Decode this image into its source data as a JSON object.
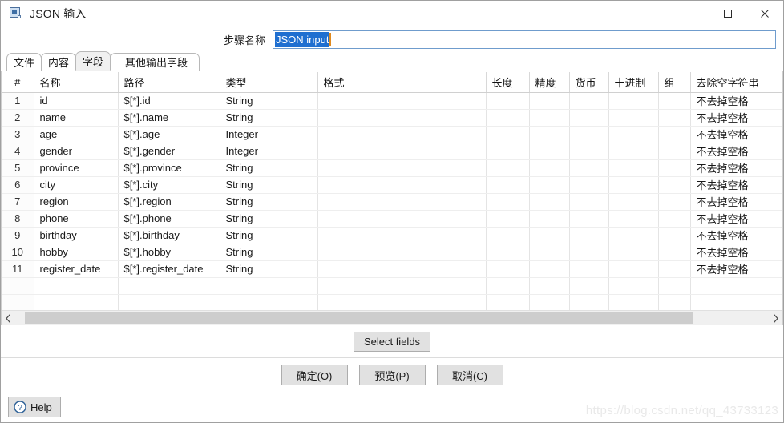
{
  "window": {
    "title": "JSON 输入",
    "icon": "json-step-icon",
    "controls": {
      "minimize": "minimize-icon",
      "maximize": "maximize-icon",
      "close": "close-icon"
    }
  },
  "step": {
    "label": "步骤名称",
    "value": "JSON input",
    "placeholder": ""
  },
  "tabs": [
    {
      "label": "文件",
      "active": false
    },
    {
      "label": "内容",
      "active": false
    },
    {
      "label": "字段",
      "active": true
    },
    {
      "label": "其他输出字段",
      "active": false
    }
  ],
  "fields_table": {
    "columns": [
      "#",
      "名称",
      "路径",
      "类型",
      "格式",
      "长度",
      "精度",
      "货币",
      "十进制",
      "组",
      "去除空字符串"
    ],
    "sort_column": "#",
    "sort_direction": "ascending",
    "rows": [
      {
        "num": "1",
        "name": "id",
        "path": "$[*].id",
        "type": "String",
        "format": "",
        "length": "",
        "precision": "",
        "currency": "",
        "decimal": "",
        "group": "",
        "trim": "不去掉空格"
      },
      {
        "num": "2",
        "name": "name",
        "path": "$[*].name",
        "type": "String",
        "format": "",
        "length": "",
        "precision": "",
        "currency": "",
        "decimal": "",
        "group": "",
        "trim": "不去掉空格"
      },
      {
        "num": "3",
        "name": "age",
        "path": "$[*].age",
        "type": "Integer",
        "format": "",
        "length": "",
        "precision": "",
        "currency": "",
        "decimal": "",
        "group": "",
        "trim": "不去掉空格"
      },
      {
        "num": "4",
        "name": "gender",
        "path": "$[*].gender",
        "type": "Integer",
        "format": "",
        "length": "",
        "precision": "",
        "currency": "",
        "decimal": "",
        "group": "",
        "trim": "不去掉空格"
      },
      {
        "num": "5",
        "name": "province",
        "path": "$[*].province",
        "type": "String",
        "format": "",
        "length": "",
        "precision": "",
        "currency": "",
        "decimal": "",
        "group": "",
        "trim": "不去掉空格"
      },
      {
        "num": "6",
        "name": "city",
        "path": "$[*].city",
        "type": "String",
        "format": "",
        "length": "",
        "precision": "",
        "currency": "",
        "decimal": "",
        "group": "",
        "trim": "不去掉空格"
      },
      {
        "num": "7",
        "name": "region",
        "path": "$[*].region",
        "type": "String",
        "format": "",
        "length": "",
        "precision": "",
        "currency": "",
        "decimal": "",
        "group": "",
        "trim": "不去掉空格"
      },
      {
        "num": "8",
        "name": "phone",
        "path": "$[*].phone",
        "type": "String",
        "format": "",
        "length": "",
        "precision": "",
        "currency": "",
        "decimal": "",
        "group": "",
        "trim": "不去掉空格"
      },
      {
        "num": "9",
        "name": "birthday",
        "path": "$[*].birthday",
        "type": "String",
        "format": "",
        "length": "",
        "precision": "",
        "currency": "",
        "decimal": "",
        "group": "",
        "trim": "不去掉空格"
      },
      {
        "num": "10",
        "name": "hobby",
        "path": "$[*].hobby",
        "type": "String",
        "format": "",
        "length": "",
        "precision": "",
        "currency": "",
        "decimal": "",
        "group": "",
        "trim": "不去掉空格"
      },
      {
        "num": "11",
        "name": "register_date",
        "path": "$[*].register_date",
        "type": "String",
        "format": "",
        "length": "",
        "precision": "",
        "currency": "",
        "decimal": "",
        "group": "",
        "trim": "不去掉空格"
      }
    ],
    "empty_rows": 4
  },
  "scrollbar": {
    "left_arrow": "chevron-left-icon",
    "right_arrow": "chevron-right-icon"
  },
  "select_fields_button": "Select fields",
  "actions": {
    "ok": "确定(O)",
    "preview": "预览(P)",
    "cancel": "取消(C)"
  },
  "help": {
    "label": "Help",
    "icon": "question-circle-icon"
  },
  "watermark": "https://blog.csdn.net/qq_43733123",
  "colors": {
    "selection_blue": "#1f6fd0",
    "caret_orange": "#e08a1e",
    "field_border": "#6f9ccd",
    "button_face": "#e1e1e1",
    "scroll_thumb": "#cdcdcd"
  }
}
